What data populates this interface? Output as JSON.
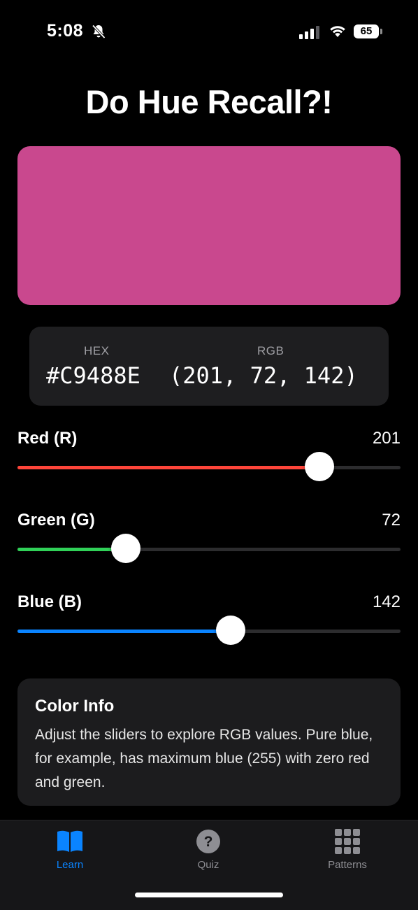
{
  "status_bar": {
    "time": "5:08",
    "battery": "65"
  },
  "app": {
    "title": "Do Hue Recall?!"
  },
  "color": {
    "swatch_hex": "#C9488E",
    "hex_label": "HEX",
    "hex_value": "#C9488E",
    "rgb_label": "RGB",
    "rgb_value": "(201, 72, 142)"
  },
  "sliders": [
    {
      "label": "Red (R)",
      "value": "201",
      "level": 201,
      "max": 255,
      "color": "#ff453a"
    },
    {
      "label": "Green (G)",
      "value": "72",
      "level": 72,
      "max": 255,
      "color": "#30d158"
    },
    {
      "label": "Blue (B)",
      "value": "142",
      "level": 142,
      "max": 255,
      "color": "#0a84ff"
    }
  ],
  "info": {
    "title": "Color Info",
    "body": "Adjust the sliders to explore RGB values. Pure blue, for example, has maximum blue (255) with zero red and green."
  },
  "tabs": [
    {
      "label": "Learn",
      "icon": "book-icon",
      "active": true
    },
    {
      "label": "Quiz",
      "icon": "question-circle-icon",
      "active": false
    },
    {
      "label": "Patterns",
      "icon": "grid-icon",
      "active": false
    }
  ],
  "colors": {
    "accent": "#0a84ff",
    "inactive": "#8e8e93"
  }
}
